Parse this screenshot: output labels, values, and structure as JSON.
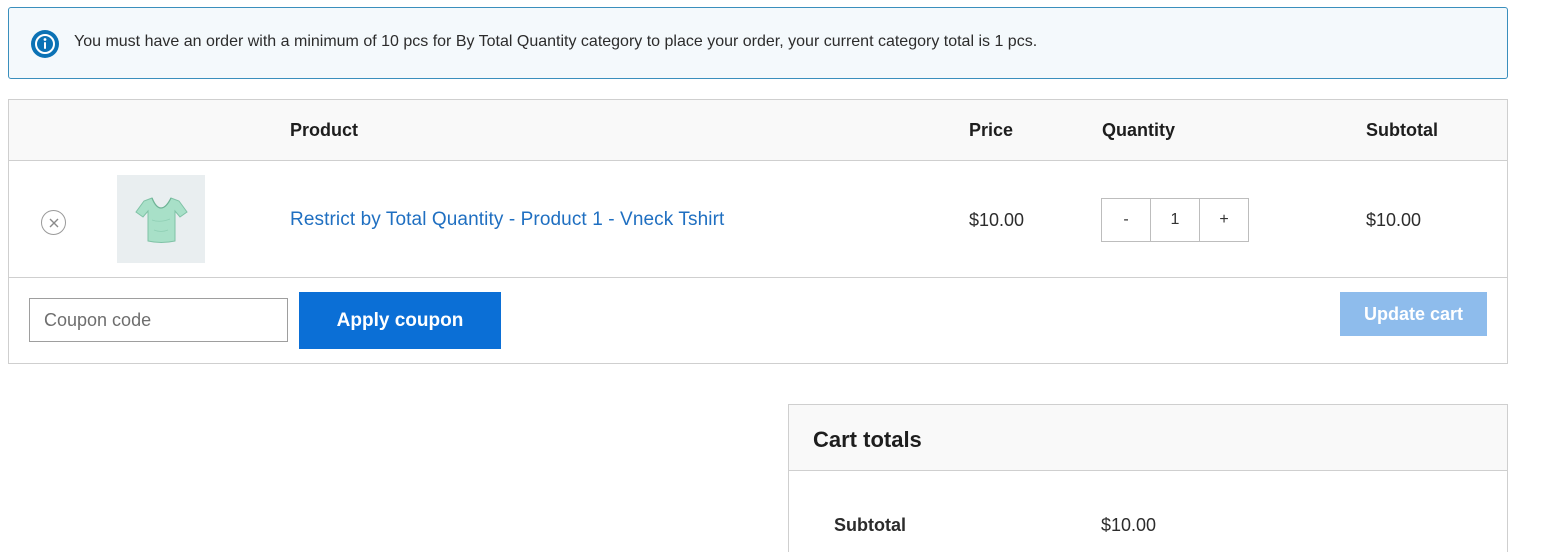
{
  "notice": {
    "icon": "info-icon",
    "color": "#0b72b5",
    "message": "You must have an order with a minimum of 10 pcs for By Total Quantity category to place your order, your current category total is 1 pcs."
  },
  "table": {
    "headers": {
      "product": "Product",
      "price": "Price",
      "quantity": "Quantity",
      "subtotal": "Subtotal"
    },
    "items": [
      {
        "remove_icon": "close-circle-icon",
        "thumbnail_icon": "tshirt-icon",
        "name": "Restrict by Total Quantity - Product 1 - Vneck Tshirt",
        "price": "$10.00",
        "quantity": "1",
        "minus_label": "-",
        "plus_label": "+",
        "subtotal": "$10.00"
      }
    ]
  },
  "actions": {
    "coupon_placeholder": "Coupon code",
    "apply_label": "Apply coupon",
    "update_label": "Update cart",
    "apply_color": "#0b6fd6",
    "update_color": "#8ebcec"
  },
  "totals": {
    "title": "Cart totals",
    "lines": [
      {
        "label": "Subtotal",
        "value": "$10.00"
      }
    ]
  }
}
